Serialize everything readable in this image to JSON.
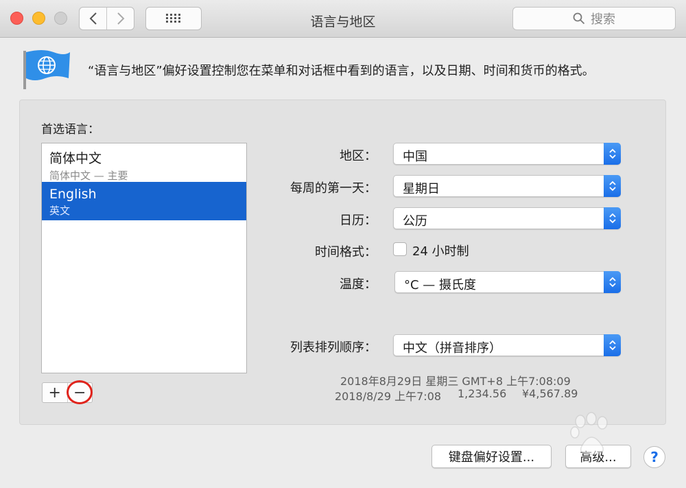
{
  "window": {
    "title": "语言与地区",
    "search_placeholder": "搜索"
  },
  "header": {
    "description": "“语言与地区”偏好设置控制您在菜单和对话框中看到的语言，以及日期、时间和货币的格式。"
  },
  "languages": {
    "label": "首选语言：",
    "items": [
      {
        "name": "简体中文",
        "detail": "简体中文 — 主要",
        "selected": false
      },
      {
        "name": "English",
        "detail": "英文",
        "selected": true
      }
    ],
    "add_label": "+",
    "remove_label": "−"
  },
  "settings": {
    "region": {
      "label": "地区：",
      "value": "中国"
    },
    "first_day": {
      "label": "每周的第一天：",
      "value": "星期日"
    },
    "calendar": {
      "label": "日历：",
      "value": "公历"
    },
    "time_format": {
      "label": "时间格式：",
      "checkbox_label": "24 小时制",
      "checked": false
    },
    "temperature": {
      "label": "温度：",
      "value": "°C — 摄氏度"
    },
    "sort_order": {
      "label": "列表排列顺序：",
      "value": "中文（拼音排序）"
    }
  },
  "samples": {
    "line1": "2018年8月29日 星期三 GMT+8 上午7:08:09",
    "line2_date": "2018/8/29 上午7:08",
    "line2_number": "1,234.56",
    "line2_currency": "¥4,567.89"
  },
  "buttons": {
    "keyboard": "键盘偏好设置...",
    "advanced": "高级...",
    "help": "?"
  },
  "colors": {
    "selection": "#1764cf",
    "popup_arrow": "#1a6ee8",
    "annotation_circle": "#e0231b"
  }
}
